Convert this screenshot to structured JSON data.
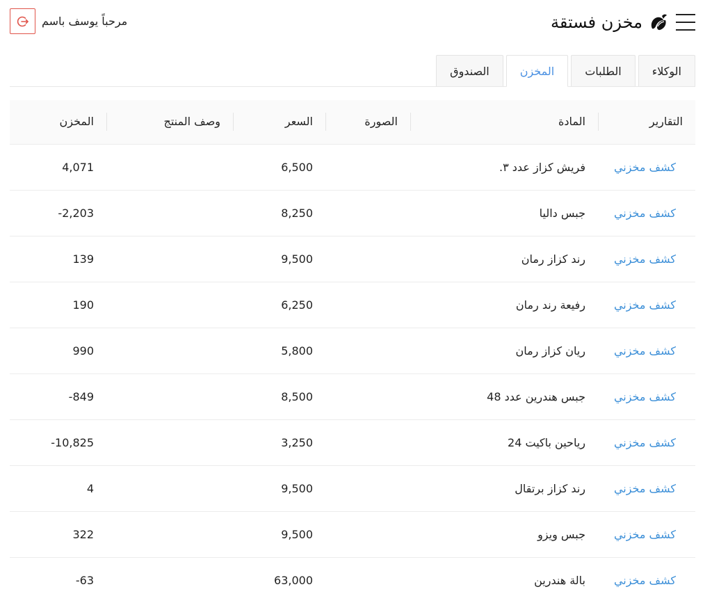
{
  "header": {
    "title": "مخزن فستقة",
    "greeting": "مرحباً يوسف باسم",
    "menu_icon": "hamburger-icon",
    "logo_icon": "pistachio-logo-icon",
    "logout_icon": "logout-icon"
  },
  "tabs": [
    {
      "label": "الوكلاء",
      "active": false
    },
    {
      "label": "الطلبات",
      "active": false
    },
    {
      "label": "المخزن",
      "active": true
    },
    {
      "label": "الصندوق",
      "active": false
    }
  ],
  "table": {
    "columns": [
      "التقارير",
      "المادة",
      "الصورة",
      "السعر",
      "وصف المنتج",
      "المخزن"
    ],
    "rows": [
      {
        "report": "كشف مخزني",
        "item": "فريش كزاز عدد ٣.",
        "image": "",
        "price": "6,500",
        "desc": "",
        "stock": "4,071"
      },
      {
        "report": "كشف مخزني",
        "item": "جبس داليا",
        "image": "",
        "price": "8,250",
        "desc": "",
        "stock": "2,203-"
      },
      {
        "report": "كشف مخزني",
        "item": "رند كزاز رمان",
        "image": "",
        "price": "9,500",
        "desc": "",
        "stock": "139"
      },
      {
        "report": "كشف مخزني",
        "item": "رفيعة رند رمان",
        "image": "",
        "price": "6,250",
        "desc": "",
        "stock": "190"
      },
      {
        "report": "كشف مخزني",
        "item": "ريان كزاز رمان",
        "image": "",
        "price": "5,800",
        "desc": "",
        "stock": "990"
      },
      {
        "report": "كشف مخزني",
        "item": "جبس هندرين عدد 48",
        "image": "",
        "price": "8,500",
        "desc": "",
        "stock": "849-"
      },
      {
        "report": "كشف مخزني",
        "item": "رياحين باكيت 24",
        "image": "",
        "price": "3,250",
        "desc": "",
        "stock": "10,825-"
      },
      {
        "report": "كشف مخزني",
        "item": "رند كزاز برتقال",
        "image": "",
        "price": "9,500",
        "desc": "",
        "stock": "4"
      },
      {
        "report": "كشف مخزني",
        "item": "جبس ويزو",
        "image": "",
        "price": "9,500",
        "desc": "",
        "stock": "322"
      },
      {
        "report": "كشف مخزني",
        "item": "بالة هندرين",
        "image": "",
        "price": "63,000",
        "desc": "",
        "stock": "63-"
      }
    ]
  },
  "colors": {
    "accent": "#3c8fd8",
    "logout_border": "#e0544a"
  }
}
